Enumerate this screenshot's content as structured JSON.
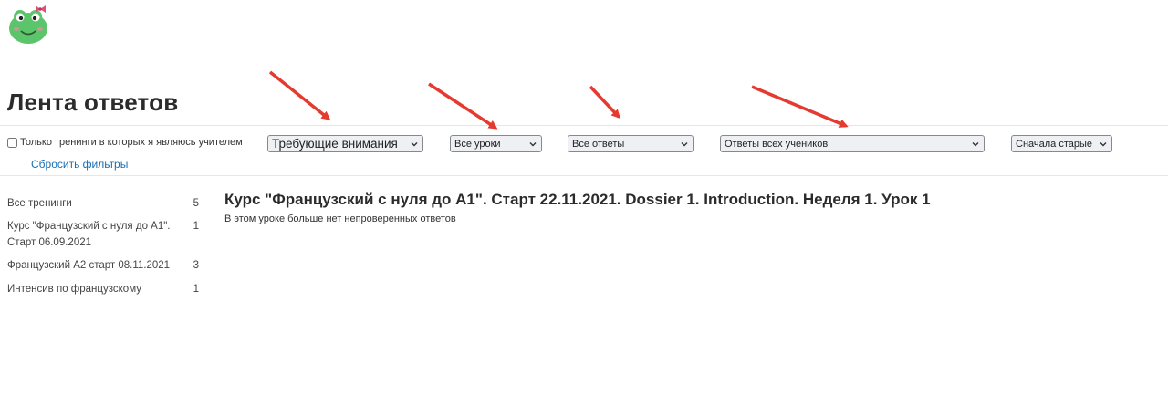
{
  "page": {
    "title": "Лента ответов"
  },
  "filters": {
    "teacher_only_label": "Только тренинги в которых я являюсь учителем",
    "teacher_only_checked": false,
    "reset_label": "Сбросить фильтры",
    "status_selected": "Требующие внимания",
    "lessons_selected": "Все уроки",
    "answers_selected": "Все ответы",
    "students_selected": "Ответы всех учеников",
    "sort_selected": "Сначала старые"
  },
  "sidebar": {
    "items": [
      {
        "label": "Все тренинги",
        "count": "5"
      },
      {
        "label": "Курс \"Французский с нуля до А1\". Старт 06.09.2021",
        "count": "1"
      },
      {
        "label": "Французский А2 старт 08.11.2021",
        "count": "3"
      },
      {
        "label": "Интенсив по французскому",
        "count": "1"
      }
    ]
  },
  "main": {
    "course_title": "Курс \"Французский с нуля до А1\". Старт 22.11.2021. Dossier 1. Introduction. Неделя 1. Урок 1",
    "message": "В этом уроке больше нет непроверенных ответов"
  },
  "colors": {
    "accent_link": "#1a6fb5",
    "annotation_arrow": "#e53a2f",
    "logo_green": "#5cc56b",
    "logo_bow": "#e0507a"
  },
  "icons": {
    "logo": "frog-mascot-icon",
    "select_chevron": "chevron-down-icon",
    "annotation": "red-arrow"
  }
}
